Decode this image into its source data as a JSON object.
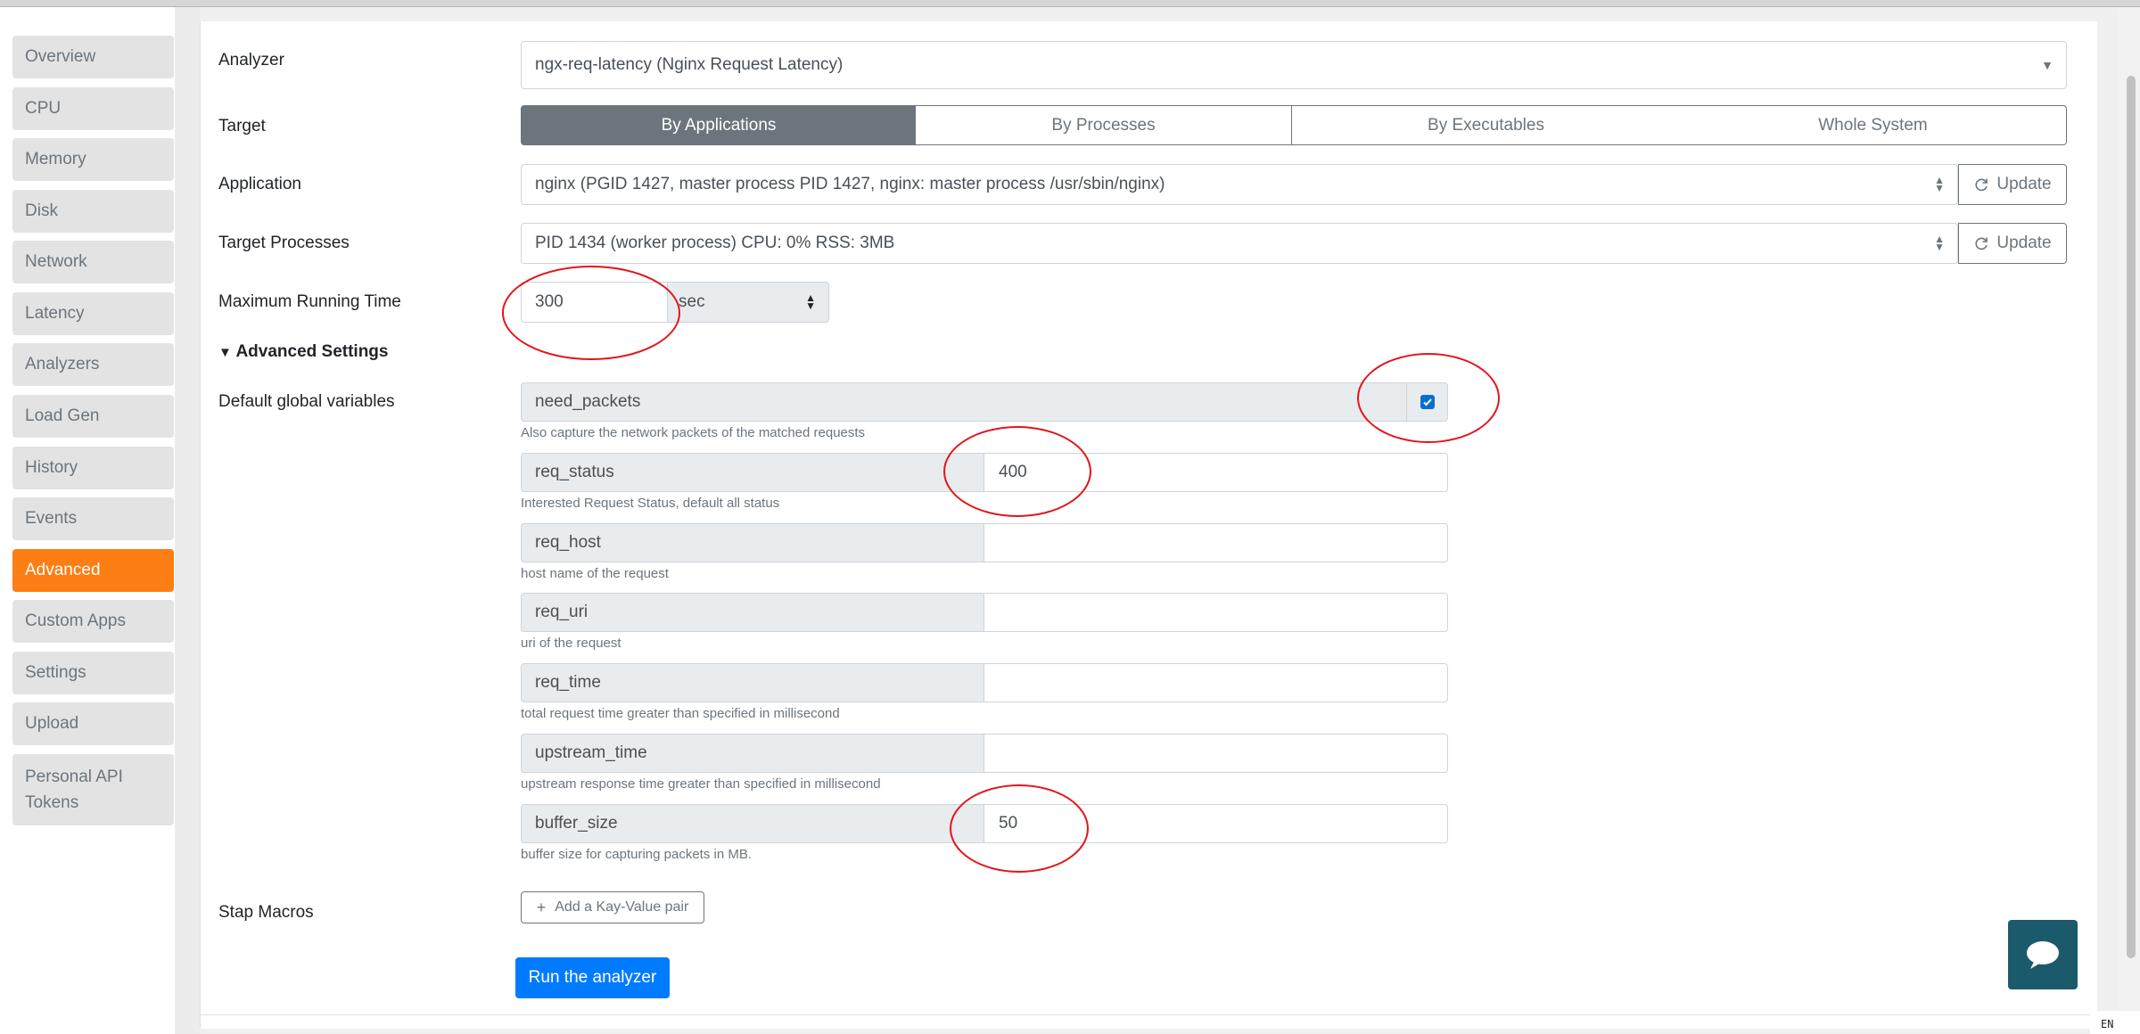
{
  "sidebar": {
    "items": [
      {
        "label": "Overview"
      },
      {
        "label": "CPU"
      },
      {
        "label": "Memory"
      },
      {
        "label": "Disk"
      },
      {
        "label": "Network"
      },
      {
        "label": "Latency"
      },
      {
        "label": "Analyzers"
      },
      {
        "label": "Load Gen"
      },
      {
        "label": "History"
      },
      {
        "label": "Events"
      },
      {
        "label": "Advanced"
      },
      {
        "label": "Custom Apps"
      },
      {
        "label": "Settings"
      },
      {
        "label": "Upload"
      },
      {
        "label": "Personal API Tokens"
      }
    ],
    "active": "Advanced"
  },
  "form": {
    "analyzer": {
      "label": "Analyzer",
      "value": "ngx-req-latency (Nginx Request Latency)"
    },
    "target": {
      "label": "Target",
      "options": [
        "By Applications",
        "By Processes",
        "By Executables",
        "Whole System"
      ],
      "selected": "By Applications"
    },
    "application": {
      "label": "Application",
      "value": "nginx (PGID 1427, master process PID 1427, nginx: master process /usr/sbin/nginx)",
      "update_label": "Update"
    },
    "target_processes": {
      "label": "Target Processes",
      "value": "PID 1434 (worker process) CPU: 0% RSS: 3MB",
      "update_label": "Update"
    },
    "max_running_time": {
      "label": "Maximum Running Time",
      "value": "300",
      "unit": "sec"
    },
    "advanced_settings": {
      "label": "Advanced Settings"
    },
    "default_globals": {
      "label": "Default global variables",
      "need_packets": {
        "name": "need_packets",
        "checked": true,
        "help": "Also capture the network packets of the matched requests"
      },
      "req_status": {
        "name": "req_status",
        "value": "400",
        "help": "Interested Request Status, default all status"
      },
      "req_host": {
        "name": "req_host",
        "value": "",
        "help": "host name of the request"
      },
      "req_uri": {
        "name": "req_uri",
        "value": "",
        "help": "uri of the request"
      },
      "req_time": {
        "name": "req_time",
        "value": "",
        "help": "total request time greater than specified in millisecond"
      },
      "upstream_time": {
        "name": "upstream_time",
        "value": "",
        "help": "upstream response time greater than specified in millisecond"
      },
      "buffer_size": {
        "name": "buffer_size",
        "value": "50",
        "help": "buffer size for capturing packets in MB."
      }
    },
    "stap_macros": {
      "label": "Stap Macros",
      "add_label": "Add a Kay-Value pair"
    },
    "run_label": "Run the analyzer"
  },
  "tray": {
    "lang": "EN"
  },
  "colors": {
    "accent": "#fd7e14",
    "primary": "#007bff",
    "secondary": "#6c757d",
    "annotation": "#e3141a",
    "chat": "#1b5a6b"
  }
}
